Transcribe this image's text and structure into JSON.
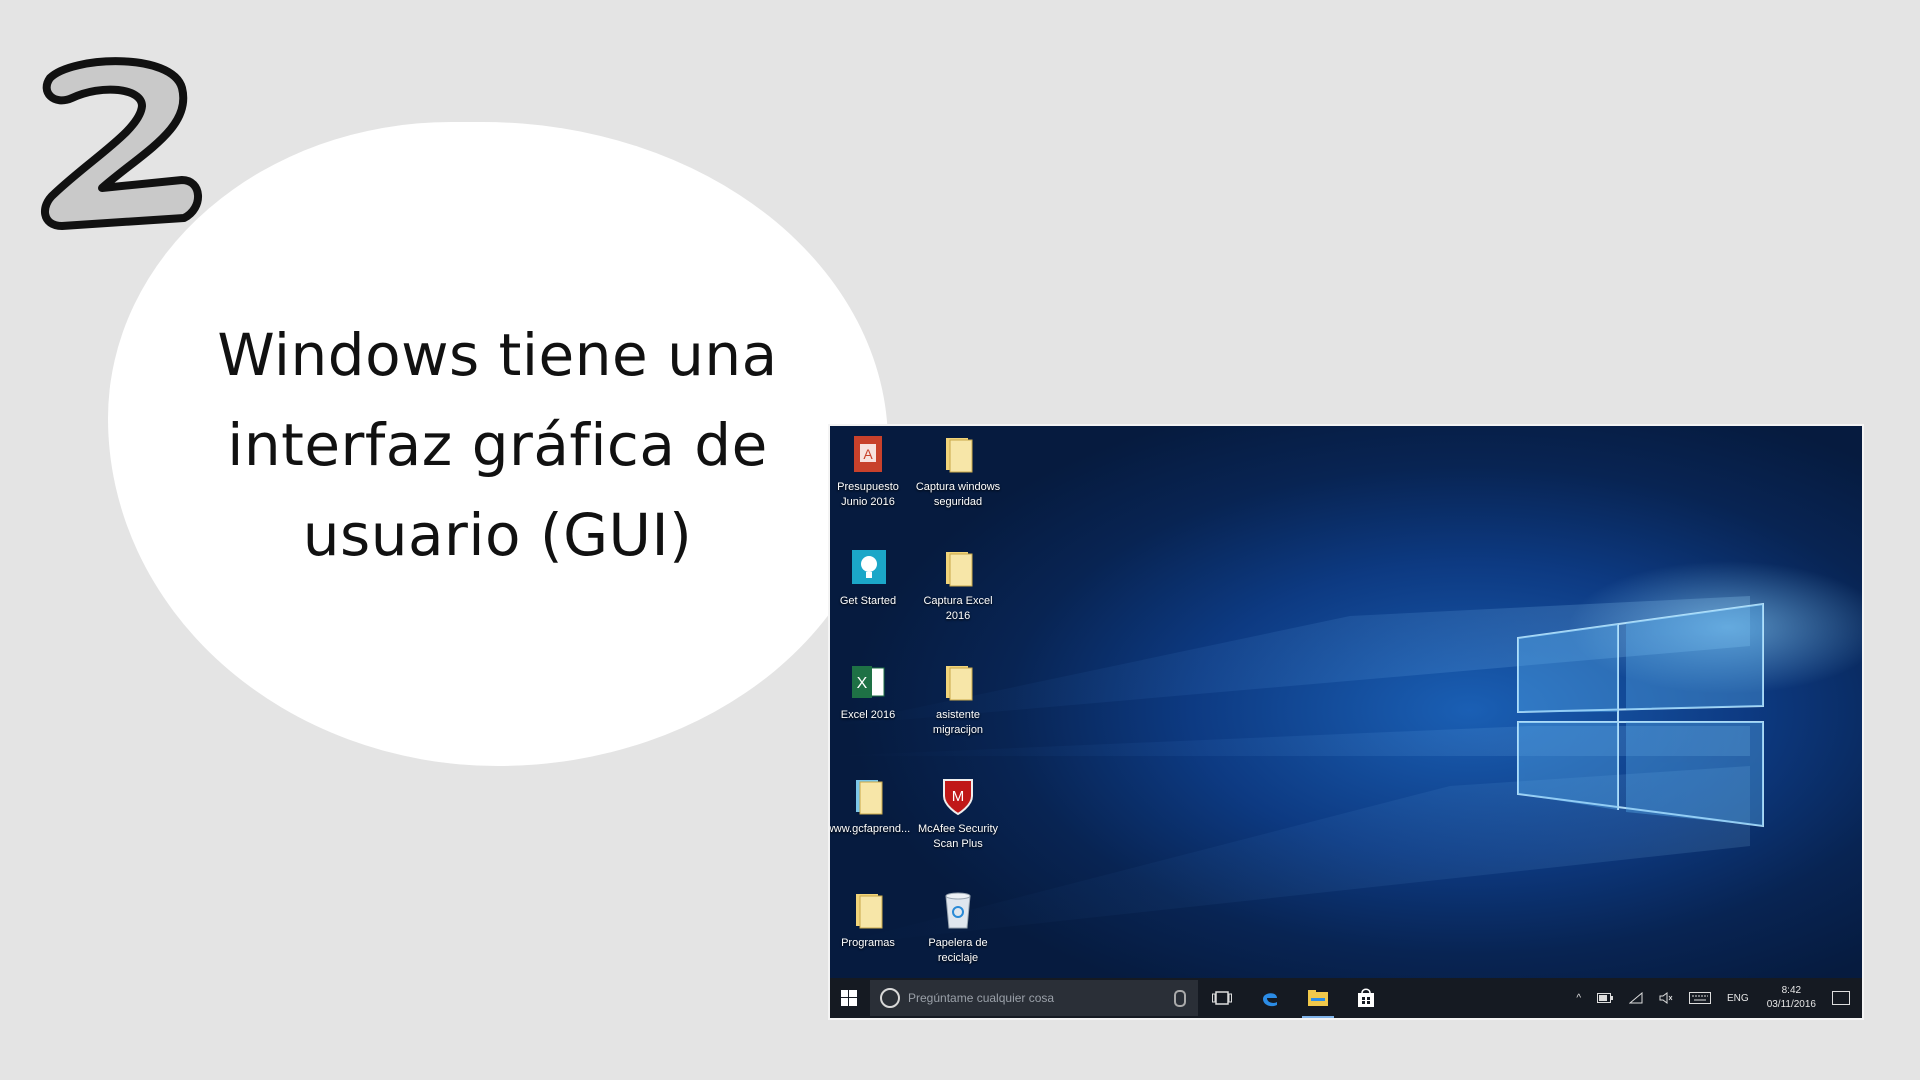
{
  "slide": {
    "number": "2.",
    "text_line1": "Windows tiene una",
    "text_line2": "interfaz gráfica de",
    "text_line3": "usuario (GUI)"
  },
  "desktop": {
    "icons": [
      {
        "icon": "pdf-icon",
        "label1": "Presupuesto",
        "label2": "Junio 2016"
      },
      {
        "icon": "folder-icon",
        "label1": "Captura windows",
        "label2": "seguridad"
      },
      {
        "icon": "get-started-icon",
        "label1": "Get Started",
        "label2": ""
      },
      {
        "icon": "folder-icon",
        "label1": "Captura Excel",
        "label2": "2016"
      },
      {
        "icon": "excel-icon",
        "label1": "Excel 2016",
        "label2": ""
      },
      {
        "icon": "folder-icon",
        "label1": "asistente",
        "label2": "migracijon"
      },
      {
        "icon": "folder-icon",
        "label1": "www.gcfaprend...",
        "label2": ""
      },
      {
        "icon": "mcafee-icon",
        "label1": "McAfee Security",
        "label2": "Scan Plus"
      },
      {
        "icon": "folder-icon",
        "label1": "Programas",
        "label2": ""
      },
      {
        "icon": "recycle-bin-icon",
        "label1": "Papelera de",
        "label2": "reciclaje"
      }
    ]
  },
  "taskbar": {
    "search_placeholder": "Pregúntame cualquier cosa",
    "apps": [
      "task-view-icon",
      "edge-icon",
      "file-explorer-icon",
      "store-icon"
    ],
    "tray": {
      "language": "ENG",
      "time": "8:42",
      "date": "03/11/2016"
    }
  },
  "colors": {
    "background": "#e4e4e4",
    "bubble": "#ffffff",
    "taskbar": "#151a22",
    "wallpaper_blue": "#0d3a82"
  }
}
